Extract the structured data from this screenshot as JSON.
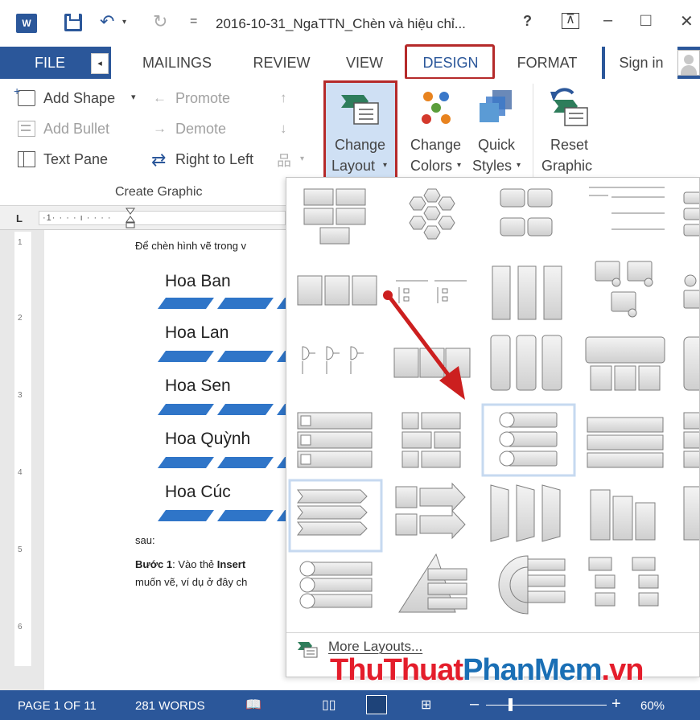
{
  "titlebar": {
    "title": "2016-10-31_NgaTTN_Chèn và hiệu chỉ...",
    "help": "?",
    "ribbon_options": "⊼",
    "minimize": "–",
    "maximize": "□",
    "close": "✕",
    "undo_icon": "↶",
    "redo_icon": "↻",
    "qat_more": "="
  },
  "tabs": {
    "file": "FILE",
    "mailings": "MAILINGS",
    "review": "REVIEW",
    "view": "VIEW",
    "design": "DESIGN",
    "format": "FORMAT",
    "sign_in": "Sign in"
  },
  "ribbon": {
    "add_shape": "Add Shape",
    "add_bullet": "Add Bullet",
    "text_pane": "Text Pane",
    "promote": "Promote",
    "demote": "Demote",
    "right_to_left": "Right to Left",
    "change_layout_1": "Change",
    "change_layout_2": "Layout",
    "change_colors_1": "Change",
    "change_colors_2": "Colors",
    "quick_styles_1": "Quick",
    "quick_styles_2": "Styles",
    "reset_1": "Reset",
    "reset_2": "Graphic",
    "group_label": "Create Graphic"
  },
  "ruler": {
    "text": "·1· · · · ı · · · ·"
  },
  "document": {
    "intro": "Để chèn hình vẽ trong v",
    "items": [
      "Hoa Ban",
      "Hoa Lan",
      "Hoa Sen",
      "Hoa Quỳnh",
      "Hoa Cúc"
    ],
    "sau": "sau:",
    "step_bold": "Bước 1",
    "step_text": ": Vào thẻ ",
    "step_insert": "Insert",
    "step_line2": "muốn vẽ, ví dụ ở đây ch"
  },
  "gallery": {
    "more_layouts": "More Layouts..."
  },
  "statusbar": {
    "page": "PAGE 1 OF 11",
    "words": "281 WORDS",
    "zoom": "60%",
    "zoom_minus": "–",
    "zoom_plus": "+"
  },
  "watermark": {
    "part1": "ThuThuat",
    "part2": "PhanMem",
    "part3": ".vn"
  },
  "colors": {
    "accent": "#2b579a",
    "highlight_red": "#b52a2a",
    "selected_blue": "#cfe0f4",
    "stripe_blue": "#2f75c8",
    "arrow_red": "#cc1f1f"
  }
}
